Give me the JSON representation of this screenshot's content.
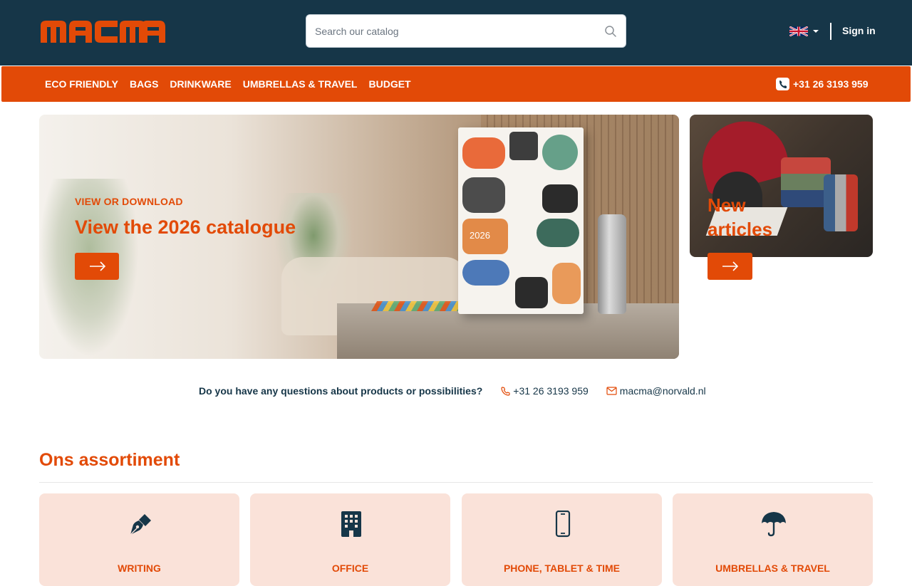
{
  "header": {
    "logo": "MACMA",
    "search": {
      "placeholder": "Search our catalog"
    },
    "language": "en",
    "signin_label": "Sign in"
  },
  "nav": {
    "items": [
      "ECO FRIENDLY",
      "BAGS",
      "DRINKWARE",
      "UMBRELLAS & TRAVEL",
      "BUDGET"
    ],
    "phone": "+31 26 3193 959"
  },
  "hero": {
    "eyebrow": "VIEW OR DOWNLOAD",
    "title": "View the 2026 catalogue",
    "catalogue_year": "2026"
  },
  "side_banner": {
    "title": "New articles"
  },
  "contact": {
    "question": "Do you have any questions about products or possibilities?",
    "phone": "+31 26 3193 959",
    "email": "macma@norvald.nl"
  },
  "assortment": {
    "title": "Ons assortiment",
    "categories": [
      {
        "label": "WRITING",
        "icon": "pen-nib-icon"
      },
      {
        "label": "OFFICE",
        "icon": "building-icon"
      },
      {
        "label": "PHONE, TABLET & TIME",
        "icon": "smartphone-icon"
      },
      {
        "label": "UMBRELLAS & TRAVEL",
        "icon": "umbrella-icon"
      }
    ]
  },
  "colors": {
    "primary_orange": "#e24a07",
    "navy": "#163648",
    "card_bg": "#fae2d9"
  }
}
